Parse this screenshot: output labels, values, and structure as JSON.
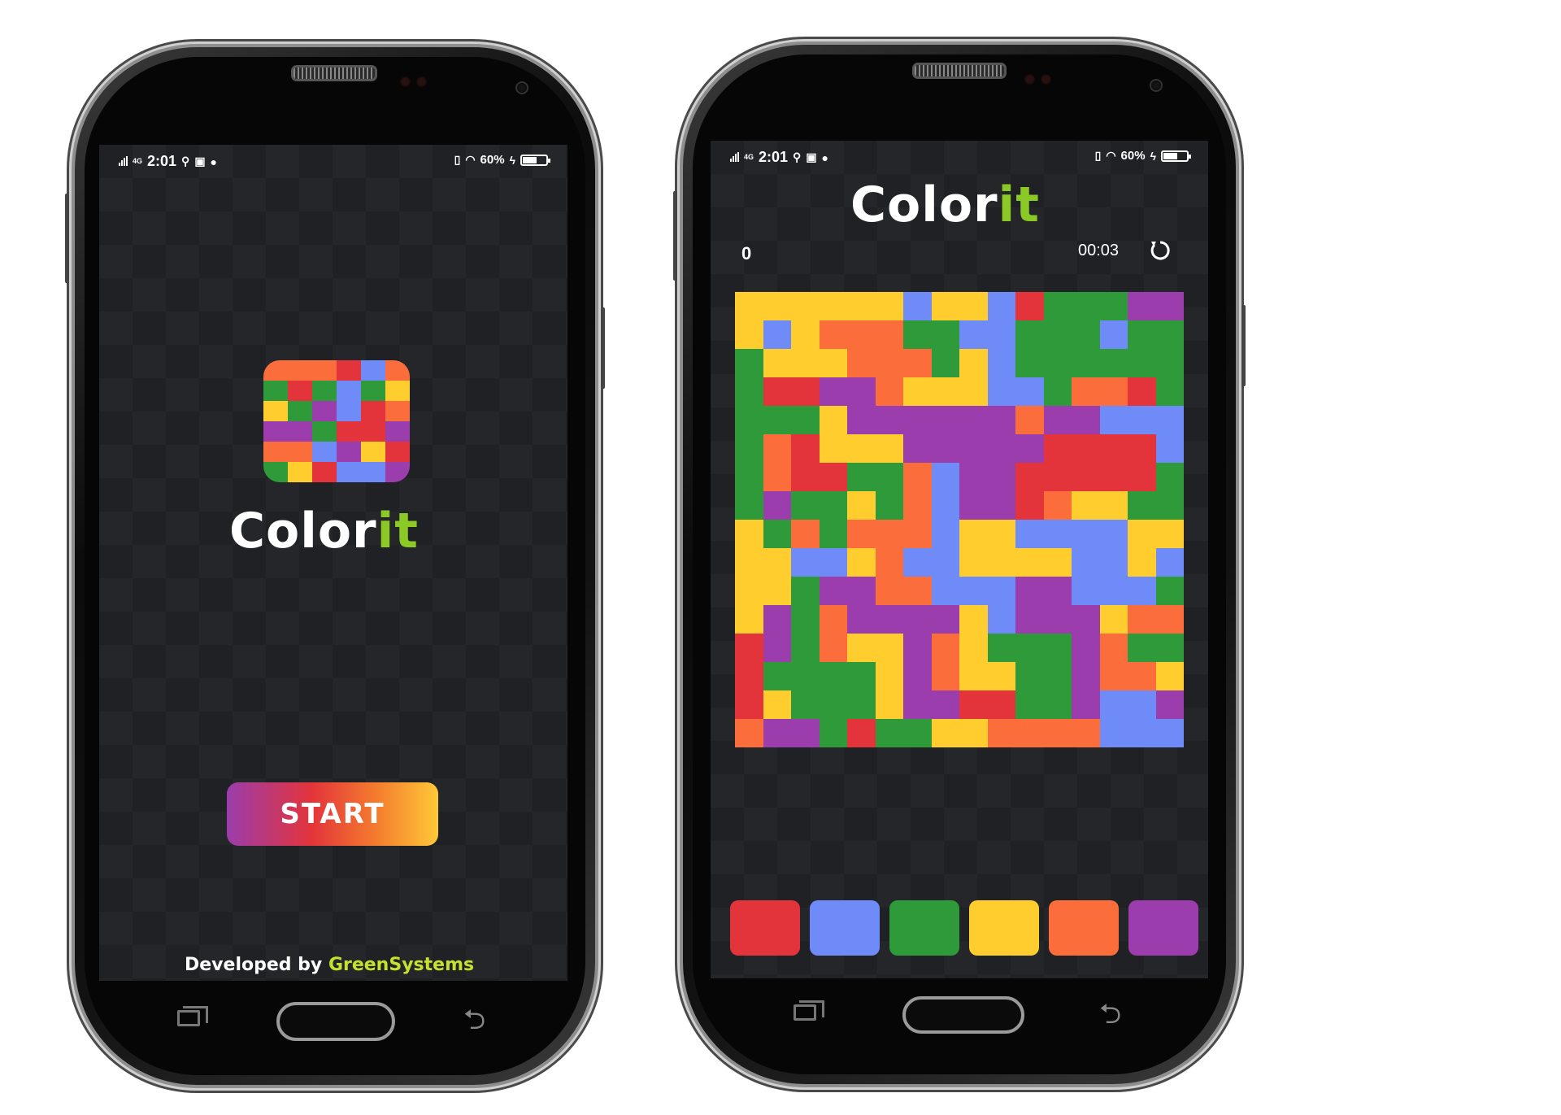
{
  "colors": {
    "red": "#e3343b",
    "blue": "#6e8bf7",
    "green": "#2e9a3a",
    "yellow": "#ffcd2e",
    "orange": "#fb6e3c",
    "purple": "#9b3dac",
    "accent_green": "#8ac926",
    "brand_green": "#c6e02f"
  },
  "status": {
    "time": "2:01",
    "network": "4G",
    "battery": "60%",
    "battery_level": 0.6
  },
  "splash": {
    "logo_main": "Color",
    "logo_accent": "it",
    "start_label": "START",
    "developed_by": "Developed by",
    "developer": "GreenSystems",
    "icon_grid": [
      "orange",
      "orange",
      "orange",
      "red",
      "blue",
      "orange",
      "green",
      "red",
      "green",
      "blue",
      "green",
      "yellow",
      "yellow",
      "green",
      "purple",
      "blue",
      "red",
      "orange",
      "purple",
      "purple",
      "green",
      "red",
      "red",
      "purple",
      "orange",
      "orange",
      "blue",
      "purple",
      "yellow",
      "red",
      "green",
      "yellow",
      "red",
      "blue",
      "blue",
      "purple"
    ]
  },
  "game": {
    "logo_main": "Color",
    "logo_accent": "it",
    "moves": "0",
    "timer": "00:03",
    "restart_icon": "restart-icon",
    "board_size": 16,
    "palette": [
      "red",
      "blue",
      "green",
      "yellow",
      "orange",
      "purple"
    ]
  },
  "nav": {
    "recent_icon": "recent-apps-icon",
    "home_icon": "home-button",
    "back_icon": "back-icon",
    "back_glyph": "⮌"
  }
}
